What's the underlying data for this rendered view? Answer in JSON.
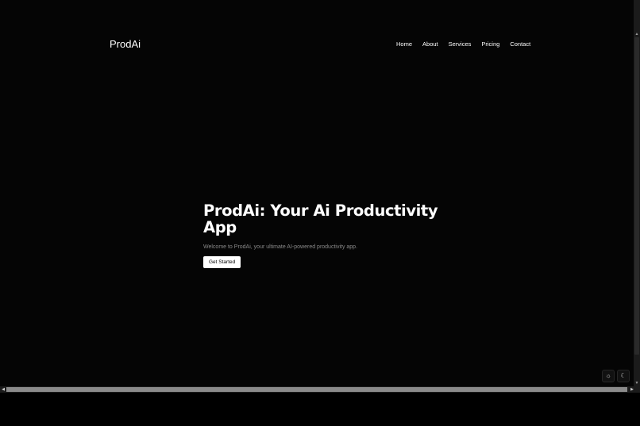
{
  "header": {
    "brand": "ProdAi",
    "nav": [
      "Home",
      "About",
      "Services",
      "Pricing",
      "Contact"
    ]
  },
  "hero": {
    "title": "ProdAi: Your Ai Productivity App",
    "subtitle": "Welcome to ProdAi, your ultimate AI-powered productivity app.",
    "cta_label": "Get Started"
  },
  "theme_toggle": {
    "light_icon": "sun-icon",
    "dark_icon": "moon-icon"
  },
  "colors": {
    "background": "#050505",
    "text": "#ffffff",
    "muted_text": "#8a8a8a",
    "button_bg": "#ffffff",
    "button_text": "#000000"
  }
}
